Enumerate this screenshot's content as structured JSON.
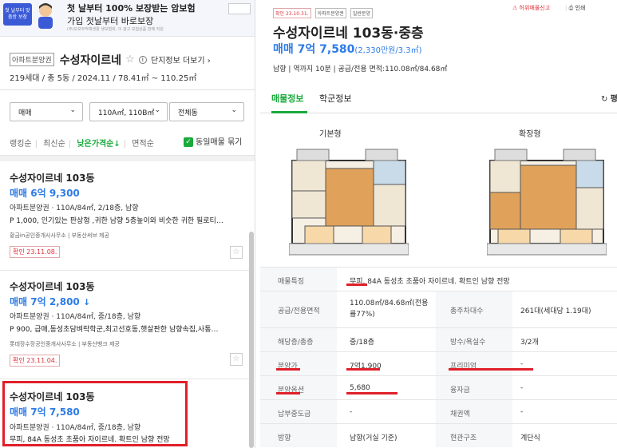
{
  "banner": {
    "logo_text": "첫 날부터 맞춤방 보장",
    "title": "첫 날부터 100% 보장받는 암보험",
    "subtitle": "가입 첫날부터 바로보장",
    "tiny": "(주)모보부적재생활 생보협회, 이 광고 보험상품 판매 직원"
  },
  "complex": {
    "badge": "아파트분양권",
    "name": "수성자이르네",
    "more": "단지정보 더보기",
    "meta": "219세대 / 총 5동 / 2024.11 / 78.41㎡ ~ 110.25㎡"
  },
  "filters": {
    "trade": "매매",
    "area": "110A㎡, 110B㎡",
    "building": "전체동"
  },
  "sort": {
    "options": [
      "랭킹순",
      "최신순",
      "낮은가격순",
      "면적순"
    ],
    "active_arrow": "↓",
    "dup_label": "동일매물 묶기"
  },
  "listings": [
    {
      "name": "수성자이르네 103동",
      "price": "매매 6억 9,300",
      "price_arrow": "",
      "spec": "아파트분양권 · 110A/84㎡, 2/18층, 남향",
      "desc": "P 1,000, 인기있는 판상형 ,귀한 남향 5층높이와 비슷한 귀한 필로티…",
      "agent": "황금in공인중개사사무소 | 부동산써브 제공",
      "confirm": "확인 23.11.08."
    },
    {
      "name": "수성자이르네 103동",
      "price": "매매 7억 2,800",
      "price_arrow": "↓",
      "spec": "아파트분양권 · 110A/84㎡, 중/18층, 남향",
      "desc": "P 900, 급매,동성초담벼락학군,최고선호동,햇살판한 남향속집,사통…",
      "agent": "롯데장수장공인중개사사무소 | 부동산뱅크 제공",
      "confirm": "확인 23.11.04."
    },
    {
      "name": "수성자이르네 103동",
      "price": "매매 7억 7,580",
      "price_arrow": "",
      "spec": "아파트분양권 · 110A/84㎡, 중/18층, 남향",
      "desc": "무피, 84A 동성초 초품아 자이르네. 확트인 남향 전망",
      "agent": "",
      "confirm": ""
    }
  ],
  "detail": {
    "tags": [
      "확인 23.10.31.",
      "아파트분양권",
      "일반분양"
    ],
    "report": "허위매물신고",
    "print": "인쇄",
    "title": "수성자이르네 103동·중층",
    "price": "매매 7억 7,580",
    "price_sub": "(2,330만원/3.3㎡)",
    "meta": "남향 | 역까지 10분 | 공급/전용 면적:110.08㎡/84.68㎡",
    "tabs": [
      "매물정보",
      "학군정보"
    ],
    "refresh_label": "평",
    "floorplans": [
      "기본형",
      "확장형"
    ],
    "feature_label": "매물특징",
    "feature_value": "무피, 84A 동성초 초품아 자이르네. 확트인 남향 전망",
    "rows": [
      {
        "h1": "공급/전용면적",
        "v1": "110.08㎡/84.68㎡(전용률77%)",
        "h2": "총주차대수",
        "v2": "261대(세대당 1.19대)"
      },
      {
        "h1": "해당층/총층",
        "v1": "중/18층",
        "h2": "방수/욕실수",
        "v2": "3/2개"
      },
      {
        "h1": "분양가",
        "v1": "7억1,900",
        "h2": "프리미엄",
        "v2": "-"
      },
      {
        "h1": "분양옵션",
        "v1": "5,680",
        "h2": "융자금",
        "v2": "-"
      },
      {
        "h1": "납부중도금",
        "v1": "-",
        "h2": "채권액",
        "v2": "-"
      },
      {
        "h1": "방향",
        "v1": "남향(거실 기준)",
        "h2": "현관구조",
        "v2": "계단식"
      }
    ]
  }
}
